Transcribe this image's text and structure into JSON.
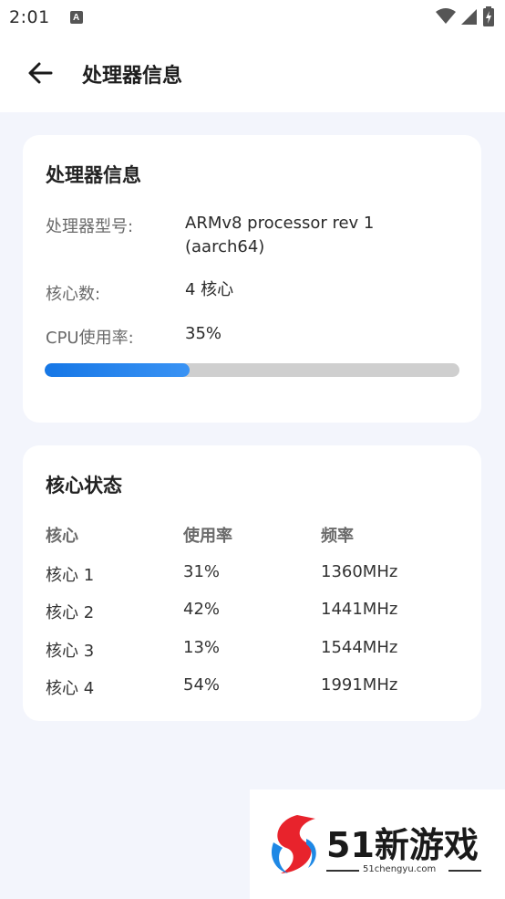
{
  "status_bar": {
    "time": "2:01",
    "app_icon_letter": "A",
    "icons": [
      "wifi-icon",
      "signal-icon",
      "battery-icon"
    ]
  },
  "app_bar": {
    "title": "处理器信息",
    "back_icon": "arrow-left-icon"
  },
  "cpu_card": {
    "title": "处理器信息",
    "model_label": "处理器型号:",
    "model_value": "ARMv8 processor rev 1 (aarch64)",
    "cores_label": "核心数:",
    "cores_value": "4 核心",
    "usage_label": "CPU使用率:",
    "usage_value": "35%",
    "usage_fraction": 0.35,
    "accent_color": "#1677e6"
  },
  "cores_card": {
    "title": "核心状态",
    "headers": [
      "核心",
      "使用率",
      "频率"
    ],
    "rows": [
      [
        "核心 1",
        "31%",
        "1360MHz"
      ],
      [
        "核心 2",
        "42%",
        "1441MHz"
      ],
      [
        "核心 3",
        "13%",
        "1544MHz"
      ],
      [
        "核心 4",
        "54%",
        "1991MHz"
      ]
    ]
  },
  "watermark": {
    "brand": "51新游戏",
    "domain": "51chengyu.com"
  }
}
